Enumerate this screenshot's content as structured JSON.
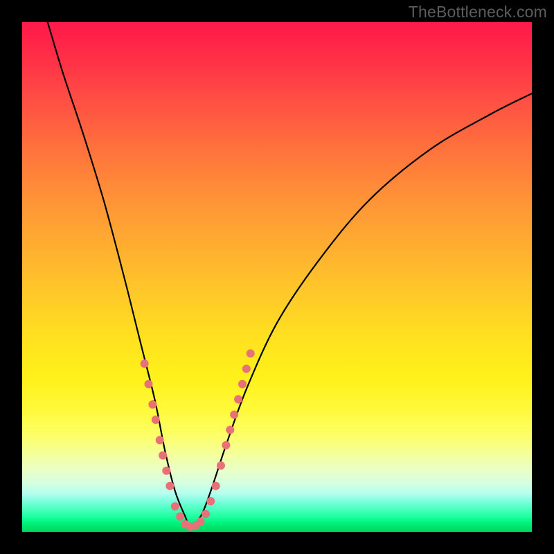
{
  "watermark": "TheBottleneck.com",
  "colors": {
    "frame_bg": "#000000",
    "curve": "#000000",
    "dot": "#e77176",
    "gradient_top": "#ff1a4a",
    "gradient_mid": "#ffe11f",
    "gradient_bottom": "#00d85e"
  },
  "chart_data": {
    "type": "line",
    "title": "",
    "xlabel": "",
    "ylabel": "",
    "xlim": [
      0,
      100
    ],
    "ylim": [
      0,
      100
    ],
    "grid": false,
    "legend": "none",
    "description": "V-shaped bottleneck curve. Background is a vertical gradient mapping y-value to color: top (y≈100) red, middle yellow, bottom (y≈0) green. Curve dips from top-left toward a minimum near x≈33 and rises back toward upper-right. Salmon dots mark sample points clustered along the lower valley of the curve.",
    "series": [
      {
        "name": "bottleneck-curve",
        "x": [
          5,
          8,
          12,
          16,
          20,
          23,
          26,
          28,
          30,
          32,
          33,
          35,
          37,
          40,
          44,
          50,
          58,
          68,
          80,
          92,
          100
        ],
        "y": [
          100,
          90,
          78,
          65,
          50,
          38,
          26,
          16,
          8,
          3,
          1,
          3,
          8,
          17,
          28,
          41,
          53,
          65,
          75,
          82,
          86
        ]
      }
    ],
    "points": [
      {
        "x": 24.0,
        "y": 33
      },
      {
        "x": 24.8,
        "y": 29
      },
      {
        "x": 25.6,
        "y": 25
      },
      {
        "x": 26.2,
        "y": 22
      },
      {
        "x": 27.0,
        "y": 18
      },
      {
        "x": 27.6,
        "y": 15
      },
      {
        "x": 28.3,
        "y": 12
      },
      {
        "x": 29.0,
        "y": 9
      },
      {
        "x": 30.0,
        "y": 5
      },
      {
        "x": 31.0,
        "y": 3
      },
      {
        "x": 32.0,
        "y": 1.5
      },
      {
        "x": 33.0,
        "y": 1
      },
      {
        "x": 34.0,
        "y": 1.2
      },
      {
        "x": 35.0,
        "y": 2
      },
      {
        "x": 36.0,
        "y": 3.5
      },
      {
        "x": 37.0,
        "y": 6
      },
      {
        "x": 38.0,
        "y": 9
      },
      {
        "x": 39.0,
        "y": 13
      },
      {
        "x": 40.0,
        "y": 17
      },
      {
        "x": 40.8,
        "y": 20
      },
      {
        "x": 41.6,
        "y": 23
      },
      {
        "x": 42.4,
        "y": 26
      },
      {
        "x": 43.2,
        "y": 29
      },
      {
        "x": 44.0,
        "y": 32
      },
      {
        "x": 44.8,
        "y": 35
      }
    ],
    "dot_radius_px": 6
  }
}
